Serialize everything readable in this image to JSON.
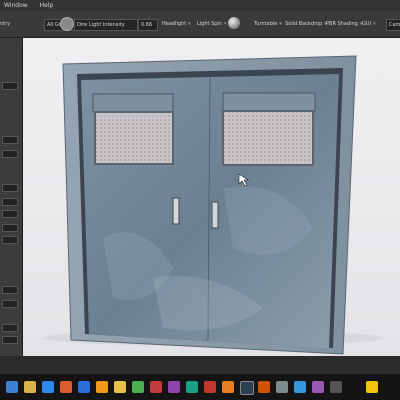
{
  "menubar": {
    "items": [
      "Window",
      "Help"
    ]
  },
  "toolbar": {
    "left_label": "ntry",
    "groups_select": "All Groups",
    "light_intensity_label": "Dire   Light Intensity",
    "light_intensity_value": "0.66",
    "headlight": "Headlight",
    "light_spin": "Light Spin",
    "turntable": "Turntable",
    "backdrop": "Solid Backdrop",
    "shading": "PBR Shading",
    "gui": "GUI",
    "camera": "Camera"
  },
  "colors": {
    "door_base": "#6f8597",
    "frame": "#8a9aa8",
    "viewport_bg": "#eceef0",
    "taskbar": "#141414"
  },
  "taskbar": {
    "icons": [
      "ie-icon",
      "files-icon",
      "windows-icon",
      "app-icon",
      "ps-icon",
      "ai-icon",
      "folder-icon",
      "chrome-icon",
      "app2-icon",
      "app3-icon",
      "app4-icon",
      "app5-icon",
      "sd-icon",
      "app6-icon",
      "app7-icon",
      "app8-icon",
      "app9-icon",
      "app10-icon",
      "app11-icon",
      "app12-icon"
    ]
  }
}
